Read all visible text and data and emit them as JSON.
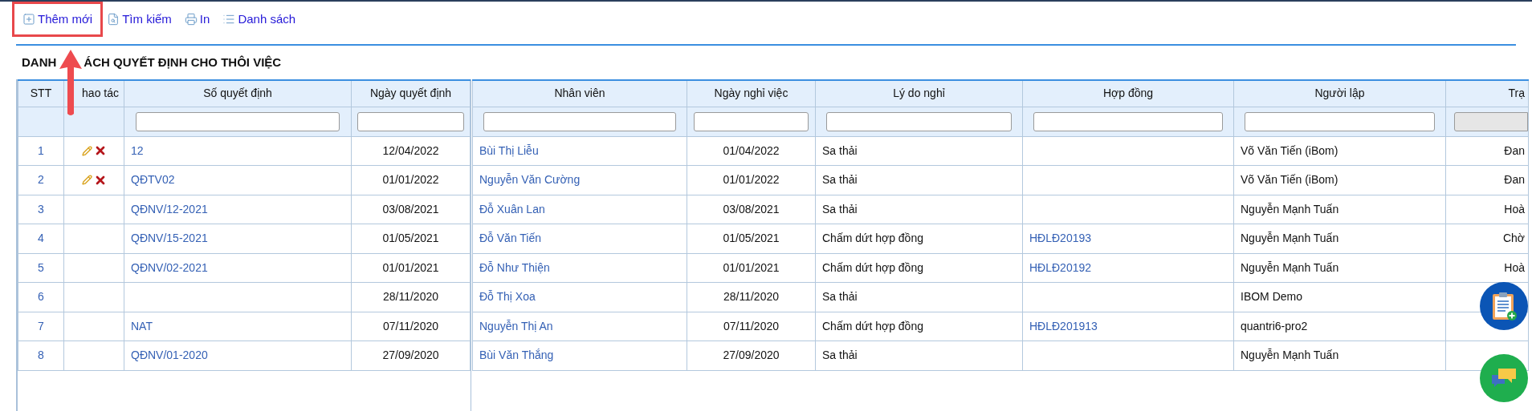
{
  "toolbar": [
    {
      "label": "Thêm mới",
      "kind": "add",
      "highlighted": true
    },
    {
      "label": "Tìm kiếm",
      "kind": "search",
      "highlighted": false
    },
    {
      "label": "In",
      "kind": "print",
      "highlighted": false
    },
    {
      "label": "Danh sách",
      "kind": "list",
      "highlighted": false
    }
  ],
  "title_parts": [
    "DANH",
    "ÁCH QUYẾT ĐỊNH CHO THÔI VIỆC"
  ],
  "left_columns": [
    {
      "label": "STT",
      "filter": false
    },
    {
      "label": "hao tác",
      "filter": false
    },
    {
      "label": "Số quyết định",
      "filter": true,
      "filter_disabled": false
    },
    {
      "label": "Ngày quyết định",
      "filter": true,
      "filter_disabled": false
    }
  ],
  "right_columns": [
    {
      "label": "Nhân viên",
      "filter": true,
      "filter_disabled": false
    },
    {
      "label": "Ngày nghỉ việc",
      "filter": true,
      "filter_disabled": false
    },
    {
      "label": "Lý do nghỉ",
      "filter": true,
      "filter_disabled": false
    },
    {
      "label": "Hợp đồng",
      "filter": true,
      "filter_disabled": false
    },
    {
      "label": "Người lập",
      "filter": true,
      "filter_disabled": false
    },
    {
      "label": "Trạ",
      "filter": true,
      "filter_disabled": true
    }
  ],
  "rows": [
    {
      "stt": "1",
      "editable": true,
      "decision_no": "12",
      "decision_date": "12/04/2022",
      "employee": "Bùi Thị Liễu",
      "leave_date": "01/04/2022",
      "reason": "Sa thải",
      "creator": "Võ Văn Tiến (iBom)",
      "status": "Đan"
    },
    {
      "stt": "2",
      "editable": true,
      "decision_no": "QĐTV02",
      "decision_date": "01/01/2022",
      "employee": "Nguyễn Văn Cường",
      "leave_date": "01/01/2022",
      "reason": "Sa thải",
      "creator": "Võ Văn Tiến (iBom)",
      "status": "Đan"
    },
    {
      "stt": "3",
      "editable": false,
      "decision_no": "QĐNV/12-2021",
      "decision_date": "03/08/2021",
      "employee": "Đỗ Xuân Lan",
      "leave_date": "03/08/2021",
      "reason": "Sa thải",
      "creator": "Nguyễn Mạnh Tuấn",
      "status": "Hoà"
    },
    {
      "stt": "4",
      "editable": false,
      "decision_no": "QĐNV/15-2021",
      "decision_date": "01/05/2021",
      "employee": "Đỗ Văn Tiến",
      "leave_date": "01/05/2021",
      "reason": "Chấm dứt hợp đồng",
      "contract": "HĐLĐ20193",
      "creator": "Nguyễn Mạnh Tuấn",
      "status": "Chờ"
    },
    {
      "stt": "5",
      "editable": false,
      "decision_no": "QĐNV/02-2021",
      "decision_date": "01/01/2021",
      "employee": "Đỗ Như Thiện",
      "leave_date": "01/01/2021",
      "reason": "Chấm dứt hợp đồng",
      "contract": "HĐLĐ20192",
      "creator": "Nguyễn Mạnh Tuấn",
      "status": "Hoà"
    },
    {
      "stt": "6",
      "editable": false,
      "decision_date": "28/11/2020",
      "employee": "Đỗ Thị Xoa",
      "leave_date": "28/11/2020",
      "reason": "Sa thải",
      "creator": "IBOM Demo"
    },
    {
      "stt": "7",
      "editable": false,
      "decision_no": "NAT",
      "decision_date": "07/11/2020",
      "employee": "Nguyễn Thị An",
      "leave_date": "07/11/2020",
      "reason": "Chấm dứt hợp đồng",
      "contract": "HĐLĐ201913",
      "creator": "quantri6-pro2"
    },
    {
      "stt": "8",
      "editable": false,
      "decision_no": "QĐNV/01-2020",
      "decision_date": "27/09/2020",
      "employee": "Bùi Văn Thắng",
      "leave_date": "27/09/2020",
      "reason": "Sa thải",
      "creator": "Nguyễn Mạnh Tuấn"
    }
  ]
}
